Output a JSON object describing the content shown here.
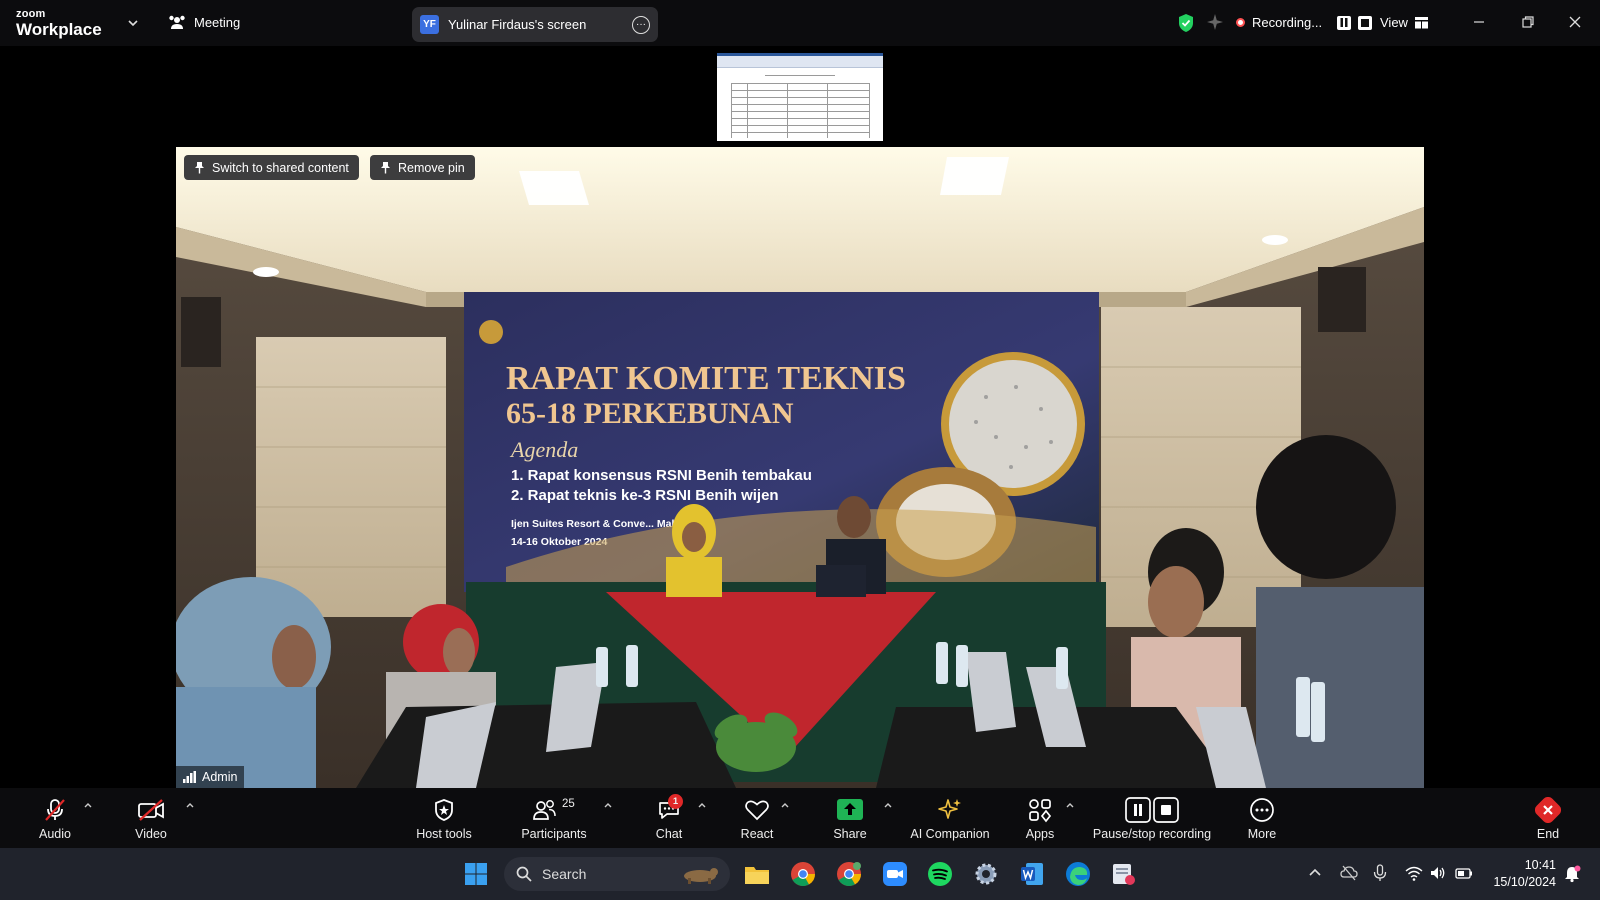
{
  "app": {
    "brand_small": "zoom",
    "brand_big": "Workplace",
    "meeting_label": "Meeting"
  },
  "share": {
    "badge": "YF",
    "screen_label": "Yulinar Firdaus's screen"
  },
  "recording": {
    "status": "Recording..."
  },
  "view": {
    "label": "View"
  },
  "video": {
    "switch_label": "Switch to shared content",
    "remove_pin_label": "Remove pin",
    "participant_name": "Admin"
  },
  "banner": {
    "title_line1": "RAPAT KOMITE TEKNIS",
    "title_line2": "65-18 PERKEBUNAN",
    "agenda_heading": "Agenda",
    "agenda_item1": "1. Rapat konsensus RSNI Benih tembakau",
    "agenda_item2": "2. Rapat teknis ke-3 RSNI Benih wijen",
    "venue": "Ijen Suites Resort & Conve... Malang,",
    "dates": "14-16 Oktober 2024"
  },
  "controls": {
    "audio": "Audio",
    "video": "Video",
    "host_tools": "Host tools",
    "participants": "Participants",
    "participants_count": "25",
    "chat": "Chat",
    "chat_badge": "1",
    "react": "React",
    "share": "Share",
    "ai_companion": "AI Companion",
    "apps": "Apps",
    "pause_stop": "Pause/stop recording",
    "more": "More",
    "end": "End"
  },
  "taskbar": {
    "search_placeholder": "Search",
    "time": "10:41",
    "date": "15/10/2024"
  },
  "colors": {
    "accent_green": "#23d160",
    "end_red": "#e02828",
    "recording_red": "#ff5252",
    "share_green": "#1fb455"
  }
}
